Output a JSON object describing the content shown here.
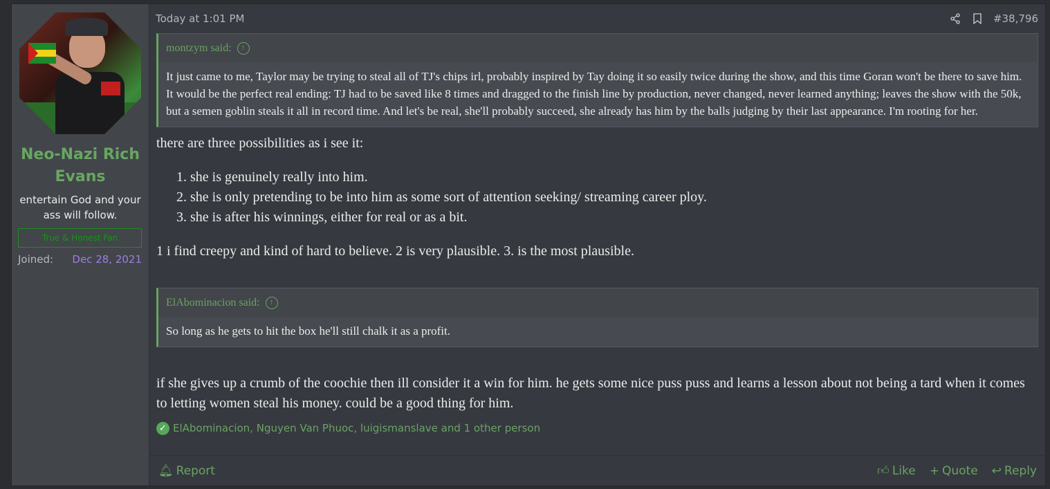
{
  "user": {
    "name": "Neo-Nazi Rich Evans",
    "title": "entertain God and your ass will follow.",
    "banner": "True & Honest Fan",
    "joined_label": "Joined:",
    "joined_date": "Dec 28, 2021"
  },
  "post": {
    "date": "Today at 1:01 PM",
    "number": "#38,796",
    "quote1": {
      "author": "montzym said:",
      "text": "It just came to me, Taylor may be trying to steal all of TJ's chips irl, probably inspired by Tay doing it so easily twice during the show, and this time Goran won't be there to save him. It would be the perfect real ending: TJ had to be saved like 8 times and dragged to the finish line by production, never changed, never learned anything; leaves the show with the 50k, but a semen goblin steals it all in record time. And let's be real, she'll probably succeed, she already has him by the balls judging by their last appearance. I'm rooting for her."
    },
    "intro": "there are three possibilities as i see it:",
    "possibilities": [
      "she is genuinely really into him.",
      "she is only pretending to be into him as some sort of attention seeking/ streaming career ploy.",
      "she is after his winnings, either for real or as a bit."
    ],
    "assessment": "1 i find creepy and kind of hard to believe. 2 is very plausible. 3. is the most plausible.",
    "quote2": {
      "author": "ElAbominacion said:",
      "text": "So long as he gets to hit the box he'll still chalk it as a profit."
    },
    "closing": "if she gives up a crumb of the coochie then ill consider it a win for him. he gets some nice puss puss and learns a lesson about not being a tard when it comes to letting women steal his money. could be a good thing for him.",
    "reactions": "ElAbominacion, Nguyen Van Phuoc, luigismanslave and 1 other person"
  },
  "footer": {
    "report": "Report",
    "like": "Like",
    "quote": "Quote",
    "reply": "Reply"
  },
  "colors": {
    "accent_green": "#6aa364",
    "background": "#36393f",
    "sidebar": "#42454a",
    "joined_date": "#9c7fe0"
  }
}
